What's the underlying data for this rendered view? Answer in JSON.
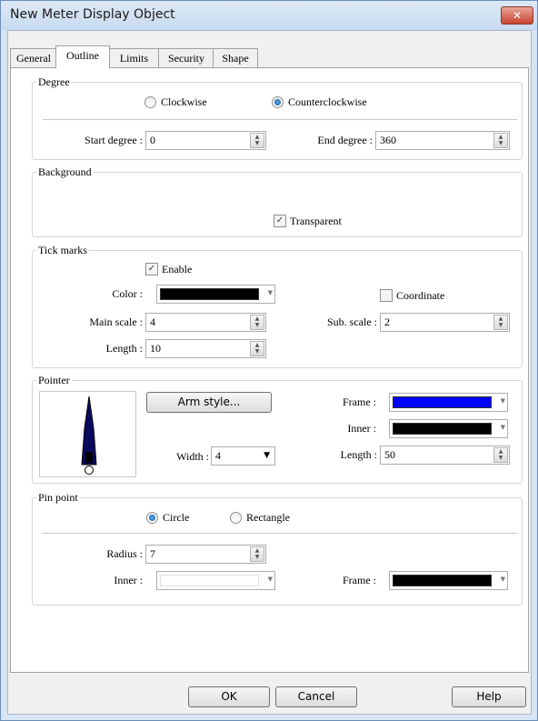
{
  "window": {
    "title": "New Meter Display Object",
    "close_glyph": "✕"
  },
  "tabs": [
    {
      "label": "General"
    },
    {
      "label": "Outline"
    },
    {
      "label": "Limits"
    },
    {
      "label": "Security"
    },
    {
      "label": "Shape"
    }
  ],
  "degree": {
    "title": "Degree",
    "clockwise": "Clockwise",
    "counterclockwise": "Counterclockwise",
    "start_label": "Start degree :",
    "start_value": "0",
    "end_label": "End degree :",
    "end_value": "360"
  },
  "background": {
    "title": "Background",
    "transparent": "Transparent"
  },
  "tick_marks": {
    "title": "Tick marks",
    "enable": "Enable",
    "color_label": "Color :",
    "color": "#000000",
    "coordinate": "Coordinate",
    "main_scale_label": "Main scale :",
    "main_scale_value": "4",
    "sub_scale_label": "Sub. scale :",
    "sub_scale_value": "2",
    "length_label": "Length :",
    "length_value": "10"
  },
  "pointer": {
    "title": "Pointer",
    "arm_style": "Arm style...",
    "width_label": "Width :",
    "width_value": "4",
    "frame_label": "Frame :",
    "frame_color": "#0000ff",
    "inner_label": "Inner :",
    "inner_color": "#000000",
    "length_label": "Length :",
    "length_value": "50"
  },
  "pin_point": {
    "title": "Pin point",
    "circle": "Circle",
    "rectangle": "Rectangle",
    "radius_label": "Radius :",
    "radius_value": "7",
    "inner_label": "Inner :",
    "inner_color": "#ffffff",
    "frame_label": "Frame :",
    "frame_color": "#000000"
  },
  "buttons": {
    "ok": "OK",
    "cancel": "Cancel",
    "help": "Help"
  },
  "glyphs": {
    "check": "✓",
    "spin_up": "▲",
    "spin_down": "▼",
    "dropdown": "▼"
  }
}
